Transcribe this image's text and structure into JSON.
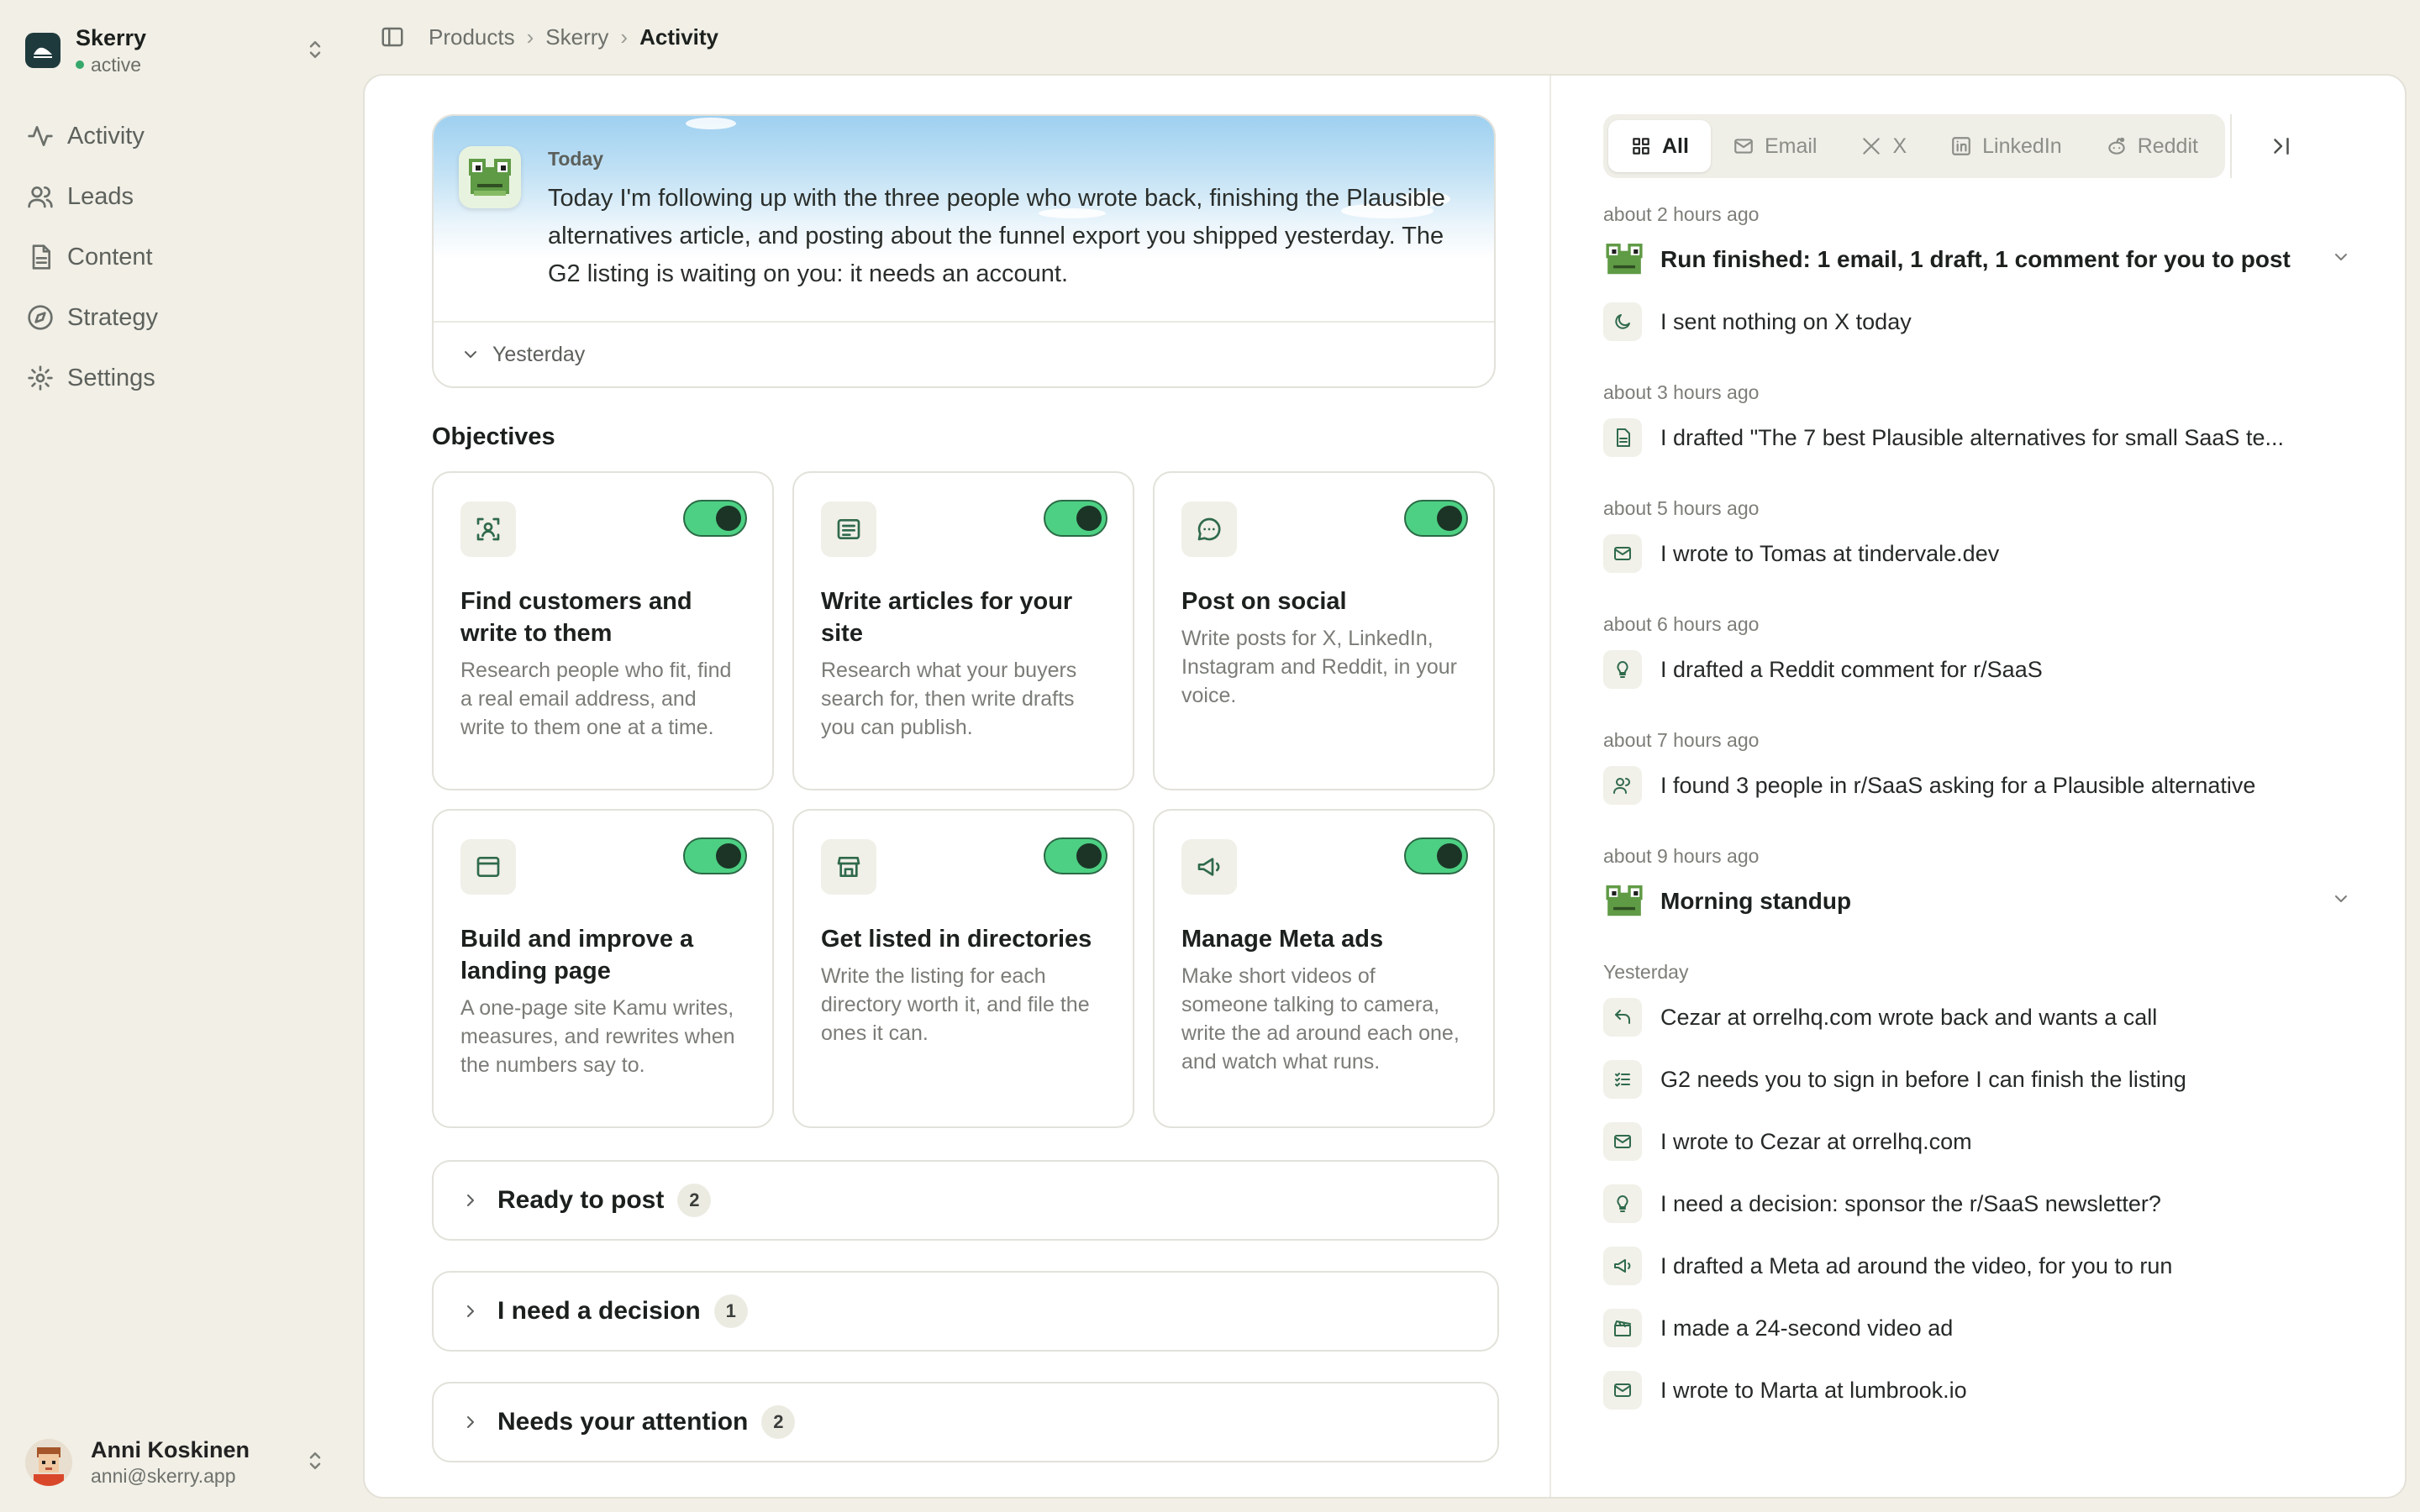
{
  "sidebar": {
    "org_name": "Skerry",
    "org_status": "active",
    "items": [
      {
        "label": "Activity",
        "icon": "activity-icon"
      },
      {
        "label": "Leads",
        "icon": "users-icon"
      },
      {
        "label": "Content",
        "icon": "document-icon"
      },
      {
        "label": "Strategy",
        "icon": "compass-icon"
      },
      {
        "label": "Settings",
        "icon": "gear-icon"
      }
    ],
    "user": {
      "name": "Anni Koskinen",
      "email": "anni@skerry.app"
    }
  },
  "breadcrumb": [
    "Products",
    "Skerry",
    "Activity"
  ],
  "brief": {
    "day": "Today",
    "text": "Today I'm following up with the three people who wrote back, finishing the Plausible alternatives article, and posting about the funnel export you shipped yesterday. The G2 listing is waiting on you: it needs an account.",
    "previous_label": "Yesterday"
  },
  "objectives": {
    "title": "Objectives",
    "cards": [
      {
        "title": "Find customers and write to them",
        "desc": "Research people who fit, find a real email address, and write to them one at a time.",
        "icon": "person-search-icon",
        "enabled": true
      },
      {
        "title": "Write articles for your site",
        "desc": "Research what your buyers search for, then write drafts you can publish.",
        "icon": "article-icon",
        "enabled": true
      },
      {
        "title": "Post on social",
        "desc": "Write posts for X, LinkedIn, Instagram and Reddit, in your voice.",
        "icon": "chat-bubble-icon",
        "enabled": true
      },
      {
        "title": "Build and improve a landing page",
        "desc": "A one-page site Kamu writes, measures, and rewrites when the numbers say to.",
        "icon": "browser-window-icon",
        "enabled": true
      },
      {
        "title": "Get listed in directories",
        "desc": "Write the listing for each directory worth it, and file the ones it can.",
        "icon": "storefront-icon",
        "enabled": true
      },
      {
        "title": "Manage Meta ads",
        "desc": "Make short videos of someone talking to camera, write the ad around each one, and watch what runs.",
        "icon": "megaphone-icon",
        "enabled": true
      }
    ]
  },
  "groups": [
    {
      "title": "Ready to post",
      "count": "2"
    },
    {
      "title": "I need a decision",
      "count": "1"
    },
    {
      "title": "Needs your attention",
      "count": "2"
    }
  ],
  "feed": {
    "tabs": [
      {
        "label": "All",
        "icon": "grid-icon",
        "active": true
      },
      {
        "label": "Email",
        "icon": "mail-icon",
        "active": false
      },
      {
        "label": "X",
        "icon": "x-logo-icon",
        "active": false
      },
      {
        "label": "LinkedIn",
        "icon": "linkedin-icon",
        "active": false
      },
      {
        "label": "Reddit",
        "icon": "reddit-icon",
        "active": false
      }
    ],
    "times": [
      "about 2 hours ago",
      "about 3 hours ago",
      "about 5 hours ago",
      "about 6 hours ago",
      "about 7 hours ago",
      "about 9 hours ago",
      "Yesterday"
    ],
    "entries": [
      "Run finished: 1 email, 1 draft, 1 comment for you to post",
      "I sent nothing on X today",
      "I drafted \"The 7 best Plausible alternatives for small SaaS te...",
      "I wrote to Tomas at tindervale.dev",
      "I drafted a Reddit comment for r/SaaS",
      "I found 3 people in r/SaaS asking for a Plausible alternative",
      "Morning standup",
      "Cezar at orrelhq.com wrote back and wants a call",
      "G2 needs you to sign in before I can finish the listing",
      "I wrote to Cezar at orrelhq.com",
      "I need a decision: sponsor the r/SaaS newsletter?",
      "I drafted a Meta ad around the video, for you to run",
      "I made a 24-second video ad",
      "I wrote to Marta at lumbrook.io"
    ]
  },
  "colors": {
    "accent": "#4dd083",
    "icon_green": "#2f6a4b",
    "background": "#f1efe6"
  }
}
